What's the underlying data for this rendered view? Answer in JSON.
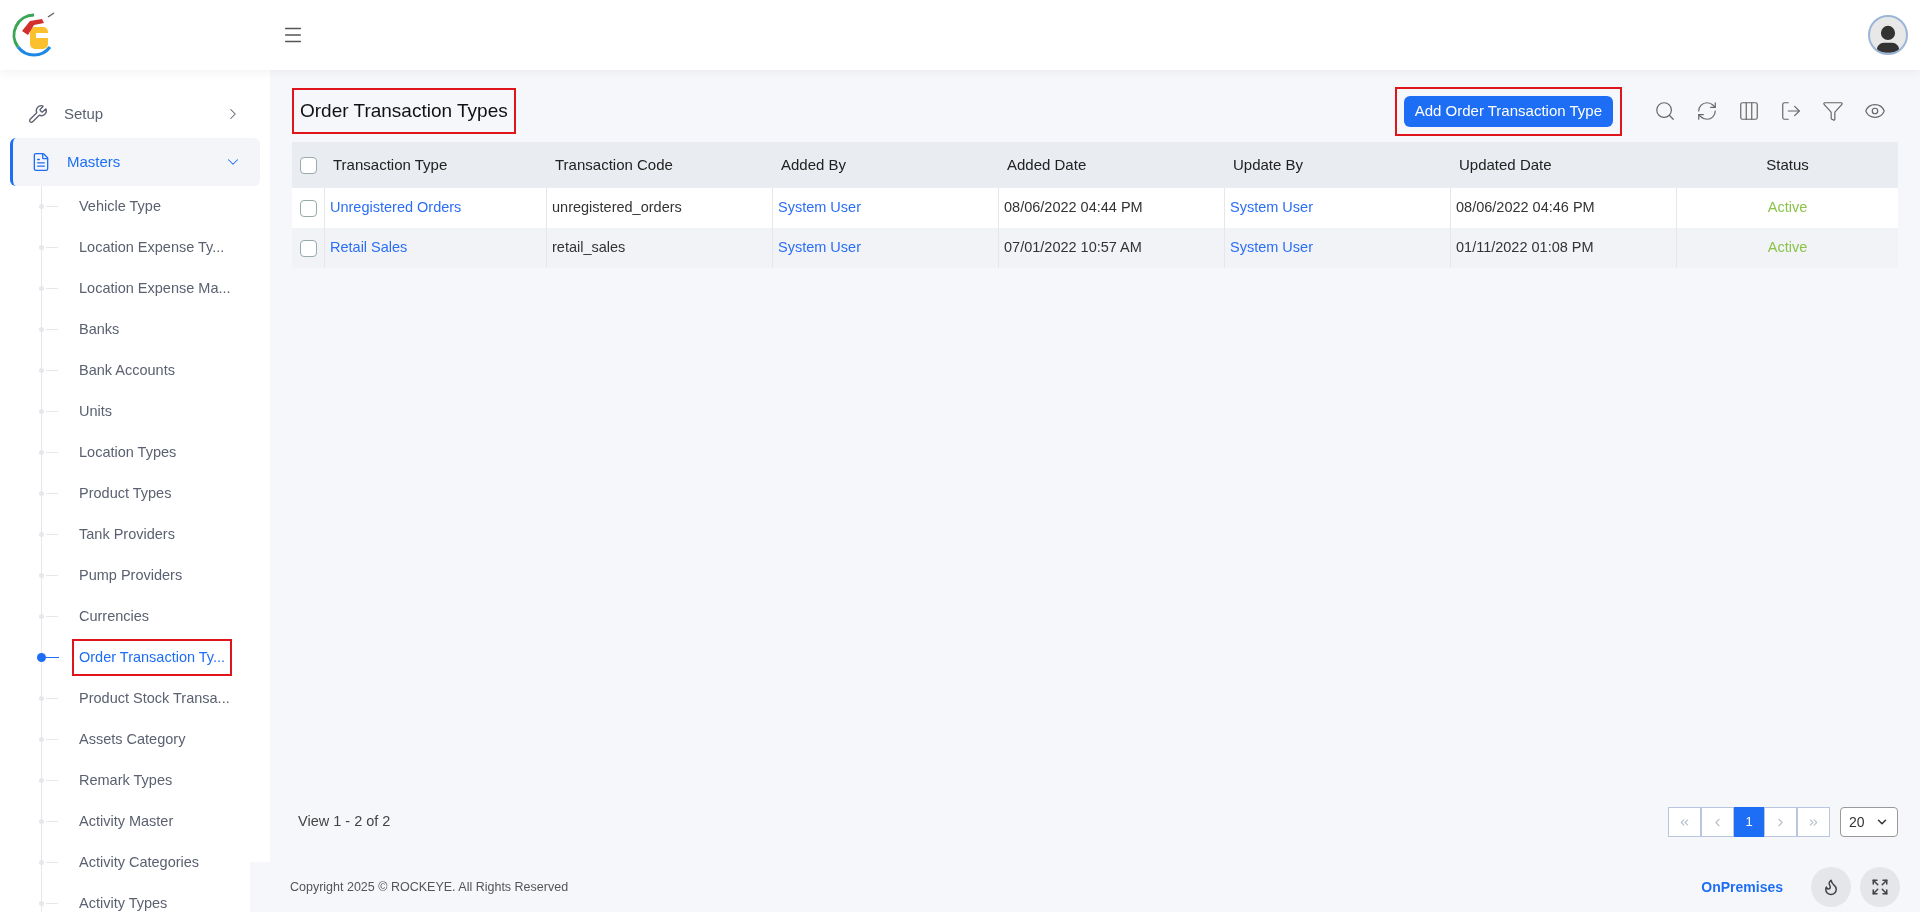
{
  "sidebar": {
    "items": [
      {
        "label": "Setup",
        "kind": "setup",
        "expanded": false,
        "selected": false
      },
      {
        "label": "Masters",
        "kind": "masters",
        "expanded": true,
        "selected": true
      }
    ],
    "children": [
      {
        "label": "Vehicle Type",
        "selected": false,
        "highlighted": false
      },
      {
        "label": "Location Expense Ty...",
        "selected": false,
        "highlighted": false
      },
      {
        "label": "Location Expense Ma...",
        "selected": false,
        "highlighted": false
      },
      {
        "label": "Banks",
        "selected": false,
        "highlighted": false
      },
      {
        "label": "Bank Accounts",
        "selected": false,
        "highlighted": false
      },
      {
        "label": "Units",
        "selected": false,
        "highlighted": false
      },
      {
        "label": "Location Types",
        "selected": false,
        "highlighted": false
      },
      {
        "label": "Product Types",
        "selected": false,
        "highlighted": false
      },
      {
        "label": "Tank Providers",
        "selected": false,
        "highlighted": false
      },
      {
        "label": "Pump Providers",
        "selected": false,
        "highlighted": false
      },
      {
        "label": "Currencies",
        "selected": false,
        "highlighted": false
      },
      {
        "label": "Order Transaction Ty...",
        "selected": true,
        "highlighted": true
      },
      {
        "label": "Product Stock Transa...",
        "selected": false,
        "highlighted": false
      },
      {
        "label": "Assets Category",
        "selected": false,
        "highlighted": false
      },
      {
        "label": "Remark Types",
        "selected": false,
        "highlighted": false
      },
      {
        "label": "Activity Master",
        "selected": false,
        "highlighted": false
      },
      {
        "label": "Activity Categories",
        "selected": false,
        "highlighted": false
      },
      {
        "label": "Activity Types",
        "selected": false,
        "highlighted": false
      }
    ]
  },
  "page": {
    "title": "Order Transaction Types",
    "title_highlighted": true,
    "add_button": "Add Order Transaction Type",
    "add_button_highlighted": true,
    "toolbar": [
      {
        "kind": "search"
      },
      {
        "kind": "refresh"
      },
      {
        "kind": "columns"
      },
      {
        "kind": "export"
      },
      {
        "kind": "filter"
      },
      {
        "kind": "view"
      }
    ]
  },
  "table": {
    "select_all_checked": false,
    "columns": [
      "Transaction Type",
      "Transaction Code",
      "Added By",
      "Added Date",
      "Update By",
      "Updated Date",
      "Status"
    ],
    "rows": [
      {
        "checked": false,
        "cells": [
          "Unregistered Orders",
          "unregistered_orders",
          "System User",
          "08/06/2022 04:44 PM",
          "System User",
          "08/06/2022 04:46 PM",
          "Active"
        ]
      },
      {
        "checked": false,
        "cells": [
          "Retail Sales",
          "retail_sales",
          "System User",
          "07/01/2022 10:57 AM",
          "System User",
          "01/11/2022 01:08 PM",
          "Active"
        ]
      }
    ]
  },
  "pager": {
    "summary": "View 1 - 2 of 2",
    "nav_before": [
      {
        "kind": "first",
        "disabled": true
      },
      {
        "kind": "prev",
        "disabled": true
      }
    ],
    "pages": [
      {
        "label": "1",
        "selected": true
      }
    ],
    "nav_after": [
      {
        "kind": "next",
        "disabled": true
      },
      {
        "kind": "last",
        "disabled": true
      }
    ],
    "page_size": "20"
  },
  "footer": {
    "copyright": "Copyright 2025 © ROCKEYE. All Rights Reserved",
    "mode": "OnPremises",
    "buttons": [
      {
        "kind": "flame"
      },
      {
        "kind": "expand"
      }
    ]
  }
}
